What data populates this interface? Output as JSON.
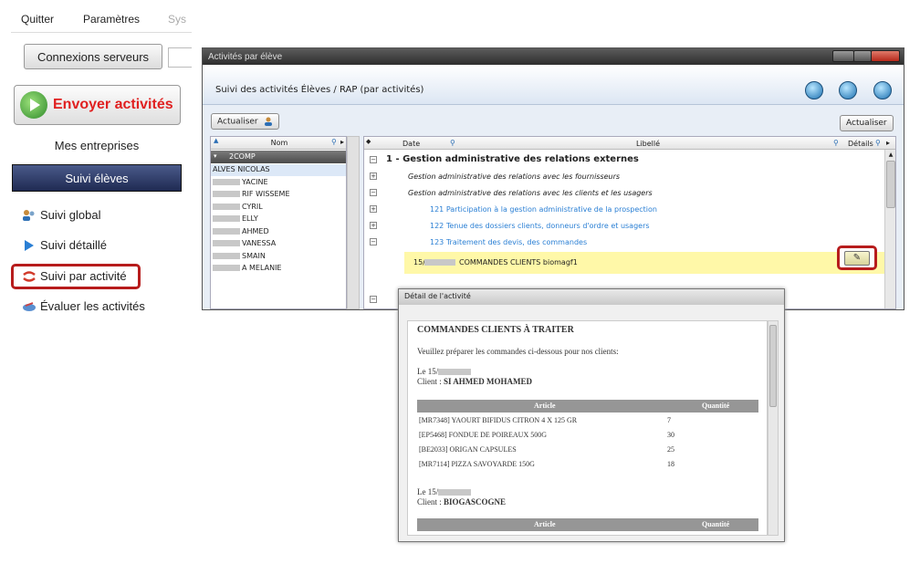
{
  "sidebar": {
    "menu": [
      "Quitter",
      "Paramètres",
      "Sys"
    ],
    "connexions_label": "Connexions serveurs",
    "envoyer_label": "Envoyer activités",
    "mes_entreprises": "Mes entreprises",
    "suivi_header": "Suivi élèves",
    "items": [
      {
        "label": "Suivi global",
        "icon": "users-icon"
      },
      {
        "label": "Suivi détaillé",
        "icon": "arrow-right-icon"
      },
      {
        "label": "Suivi par activité",
        "icon": "swap-arrows-icon"
      },
      {
        "label": "Évaluer les activités",
        "icon": "evaluate-icon"
      }
    ],
    "accent": "#e02020",
    "highlight": "#b71c1c"
  },
  "window": {
    "title": "Activités par élève",
    "subtitle": "Suivi des activités Élèves / RAP (par activités)",
    "actualiser_left": "Actualiser",
    "actualiser_right": "Actualiser"
  },
  "students": {
    "header": "Nom",
    "group": "2COMP",
    "rows": [
      {
        "name": "ALVES NICOLAS",
        "blur": false
      },
      {
        "name": "YACINE",
        "blur": true
      },
      {
        "name": "RIF WISSEME",
        "blur": true
      },
      {
        "name": "CYRIL",
        "blur": true
      },
      {
        "name": "ELLY",
        "blur": true
      },
      {
        "name": "AHMED",
        "blur": true
      },
      {
        "name": "VANESSA",
        "blur": true
      },
      {
        "name": "SMAIN",
        "blur": true
      },
      {
        "name": "A MELANIE",
        "blur": true
      }
    ]
  },
  "activities": {
    "col_date": "Date",
    "col_libelle": "Libellé",
    "col_details": "Détails",
    "section": "1 - Gestion administrative des relations externes",
    "sub1": "Gestion administrative des relations avec les fournisseurs",
    "sub2": "Gestion administrative des relations avec les clients et les usagers",
    "links": [
      "121 Participation à la gestion administrative de la prospection",
      "122 Tenue des dossiers clients, donneurs d'ordre et usagers",
      "123 Traitement des devis, des commandes"
    ],
    "selected_date": "15/",
    "selected_label": "COMMANDES CLIENTS biomagf1"
  },
  "detail": {
    "title": "Détail de l'activité",
    "heading": "COMMANDES CLIENTS À TRAITER",
    "intro": "Veuillez préparer les commandes ci-dessous pour nos clients:",
    "le1": "Le 15/",
    "client1_label": "Client : ",
    "client1": "SI AHMED MOHAMED",
    "col_article": "Article",
    "col_qty": "Quantité",
    "rows": [
      {
        "article": "[MR7348] YAOURT BIFIDUS CITRON 4 X 125 GR",
        "qty": "7"
      },
      {
        "article": "[EP5468] FONDUE DE POIREAUX 500G",
        "qty": "30"
      },
      {
        "article": "[BE2033] ORIGAN CAPSULES",
        "qty": "25"
      },
      {
        "article": "[MR7114] PIZZA SAVOYARDE 150G",
        "qty": "18"
      }
    ],
    "le2": "Le 15/",
    "client2_label": "Client : ",
    "client2": "BIOGASCOGNE"
  }
}
